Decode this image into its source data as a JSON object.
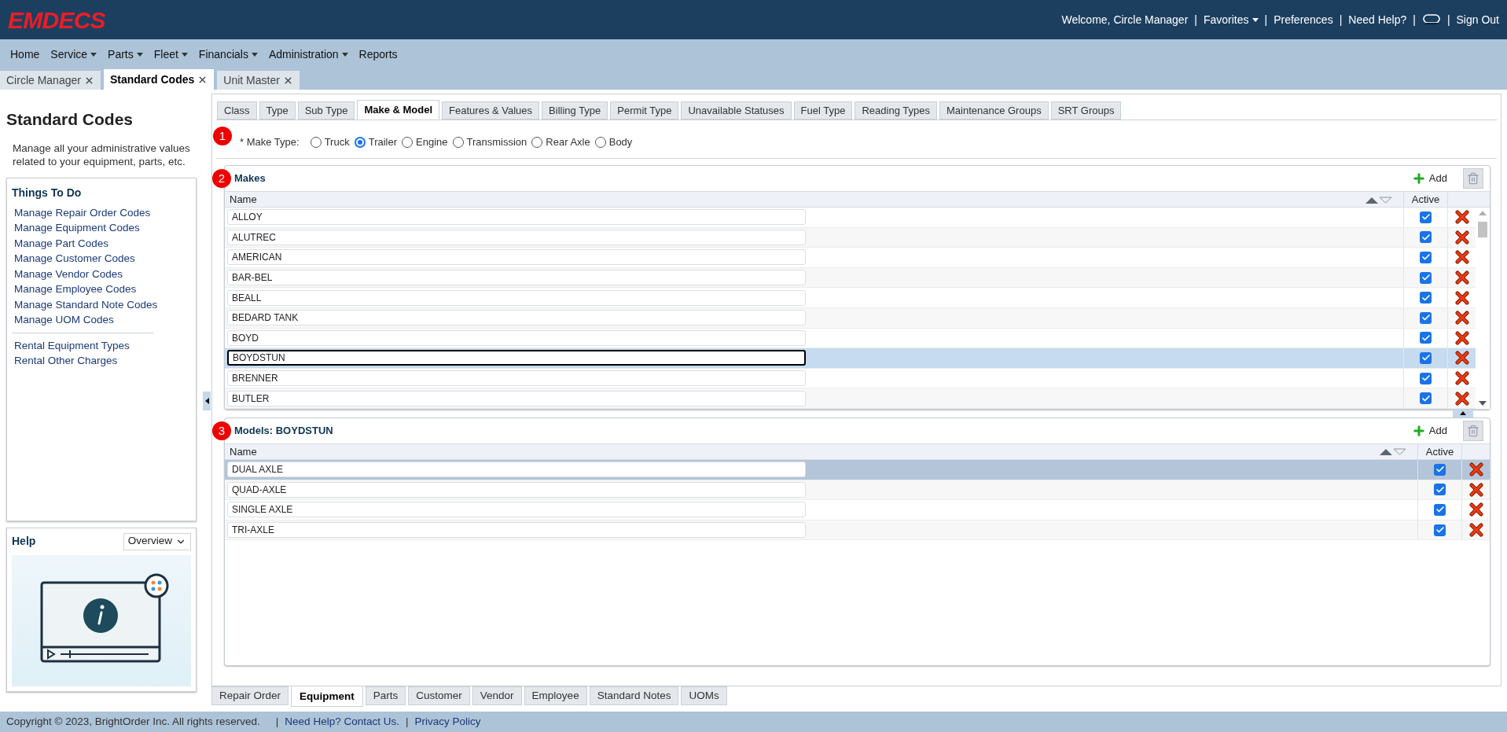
{
  "header": {
    "logo": "EMDECS",
    "links": [
      {
        "kind": "text",
        "label": "Welcome, Circle Manager"
      },
      {
        "kind": "separator",
        "label": "|"
      },
      {
        "kind": "menu",
        "label": "Favorites"
      },
      {
        "kind": "separator",
        "label": "|"
      },
      {
        "kind": "link",
        "label": "Preferences"
      },
      {
        "kind": "separator",
        "label": "|"
      },
      {
        "kind": "link",
        "label": "Need Help?"
      },
      {
        "kind": "separator",
        "label": "|"
      },
      {
        "kind": "chat"
      },
      {
        "kind": "separator",
        "label": "|"
      },
      {
        "kind": "link",
        "label": "Sign Out"
      }
    ]
  },
  "menu": [
    {
      "label": "Home",
      "dropdown": false
    },
    {
      "label": "Service",
      "dropdown": true
    },
    {
      "label": "Parts",
      "dropdown": true
    },
    {
      "label": "Fleet",
      "dropdown": true
    },
    {
      "label": "Financials",
      "dropdown": true
    },
    {
      "label": "Administration",
      "dropdown": true
    },
    {
      "label": "Reports",
      "dropdown": false
    }
  ],
  "doc_tabs": [
    {
      "label": "Circle Manager",
      "selected": false
    },
    {
      "label": "Standard Codes",
      "selected": true
    },
    {
      "label": "Unit Master",
      "selected": false
    }
  ],
  "sidebar": {
    "title": "Standard Codes",
    "description": "Manage all your administrative values related to your equipment, parts, etc.",
    "things_to_do": {
      "title": "Things To Do",
      "groups": [
        [
          "Manage Repair Order Codes",
          "Manage Equipment Codes",
          "Manage Part Codes",
          "Manage Customer Codes",
          "Manage Vendor Codes",
          "Manage Employee Codes",
          "Manage Standard Note Codes",
          "Manage UOM Codes"
        ],
        [
          "Rental Equipment Types",
          "Rental Other Charges"
        ]
      ]
    },
    "help": {
      "title": "Help",
      "dropdown": "Overview"
    }
  },
  "code_tabs": [
    {
      "label": "Class",
      "selected": false
    },
    {
      "label": "Type",
      "selected": false
    },
    {
      "label": "Sub Type",
      "selected": false
    },
    {
      "label": "Make & Model",
      "selected": true
    },
    {
      "label": "Features & Values",
      "selected": false
    },
    {
      "label": "Billing Type",
      "selected": false
    },
    {
      "label": "Permit Type",
      "selected": false
    },
    {
      "label": "Unavailable Statuses",
      "selected": false
    },
    {
      "label": "Fuel Type",
      "selected": false
    },
    {
      "label": "Reading Types",
      "selected": false
    },
    {
      "label": "Maintenance Groups",
      "selected": false
    },
    {
      "label": "SRT Groups",
      "selected": false
    }
  ],
  "make_type": {
    "step": "1",
    "label": "* Make Type:",
    "options": [
      {
        "label": "Truck",
        "selected": false
      },
      {
        "label": "Trailer",
        "selected": true
      },
      {
        "label": "Engine",
        "selected": false
      },
      {
        "label": "Transmission",
        "selected": false
      },
      {
        "label": "Rear Axle",
        "selected": false
      },
      {
        "label": "Body",
        "selected": false
      }
    ]
  },
  "makes": {
    "step": "2",
    "title": "Makes",
    "add": "Add",
    "columns": [
      "Name",
      "Active"
    ],
    "rows": [
      {
        "name": "ALLOY",
        "active": true,
        "selected": false,
        "editing": false
      },
      {
        "name": "ALUTREC",
        "active": true,
        "selected": false,
        "editing": false
      },
      {
        "name": "AMERICAN",
        "active": true,
        "selected": false,
        "editing": false
      },
      {
        "name": "BAR-BEL",
        "active": true,
        "selected": false,
        "editing": false
      },
      {
        "name": "BEALL",
        "active": true,
        "selected": false,
        "editing": false
      },
      {
        "name": "BEDARD TANK",
        "active": true,
        "selected": false,
        "editing": false
      },
      {
        "name": "BOYD",
        "active": true,
        "selected": false,
        "editing": false
      },
      {
        "name": "BOYDSTUN",
        "active": true,
        "selected": true,
        "editing": true
      },
      {
        "name": "BRENNER",
        "active": true,
        "selected": false,
        "editing": false
      },
      {
        "name": "BUTLER",
        "active": true,
        "selected": false,
        "editing": false
      }
    ]
  },
  "models": {
    "step": "3",
    "title": "Models: BOYDSTUN",
    "add": "Add",
    "columns": [
      "Name",
      "Active"
    ],
    "rows": [
      {
        "name": "DUAL AXLE",
        "active": true,
        "selected": true,
        "editing": false
      },
      {
        "name": "QUAD-AXLE",
        "active": true,
        "selected": false,
        "editing": false
      },
      {
        "name": "SINGLE AXLE",
        "active": true,
        "selected": false,
        "editing": false
      },
      {
        "name": "TRI-AXLE",
        "active": true,
        "selected": false,
        "editing": false
      }
    ]
  },
  "bottom_tabs": [
    {
      "label": "Repair Order",
      "selected": false
    },
    {
      "label": "Equipment",
      "selected": true
    },
    {
      "label": "Parts",
      "selected": false
    },
    {
      "label": "Customer",
      "selected": false
    },
    {
      "label": "Vendor",
      "selected": false
    },
    {
      "label": "Employee",
      "selected": false
    },
    {
      "label": "Standard Notes",
      "selected": false
    },
    {
      "label": "UOMs",
      "selected": false
    }
  ],
  "footer": {
    "copyright": "Copyright © 2023, BrightOrder Inc. All rights reserved.",
    "links": [
      {
        "kind": "separator",
        "label": "|"
      },
      {
        "kind": "link",
        "label": "Need Help? Contact Us."
      },
      {
        "kind": "separator",
        "label": "|"
      },
      {
        "kind": "link",
        "label": "Privacy Policy"
      }
    ]
  }
}
